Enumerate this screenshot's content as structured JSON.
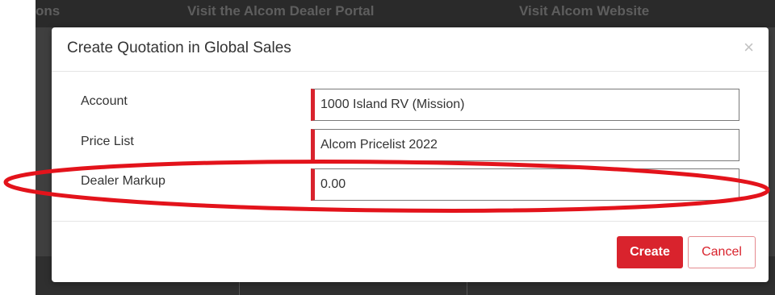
{
  "background": {
    "nav_links": [
      "ons",
      "Visit the Alcom Dealer Portal",
      "Visit Alcom Website"
    ]
  },
  "modal": {
    "title": "Create Quotation in Global Sales",
    "close_icon": "×",
    "fields": [
      {
        "label": "Account",
        "value": "1000 Island RV (Mission)"
      },
      {
        "label": "Price List",
        "value": "Alcom Pricelist 2022"
      },
      {
        "label": "Dealer Markup",
        "value": "0.00"
      }
    ],
    "buttons": {
      "create_label": "Create",
      "cancel_label": "Cancel"
    }
  },
  "colors": {
    "accent": "#d9232d",
    "annotation": "#e3131b"
  }
}
